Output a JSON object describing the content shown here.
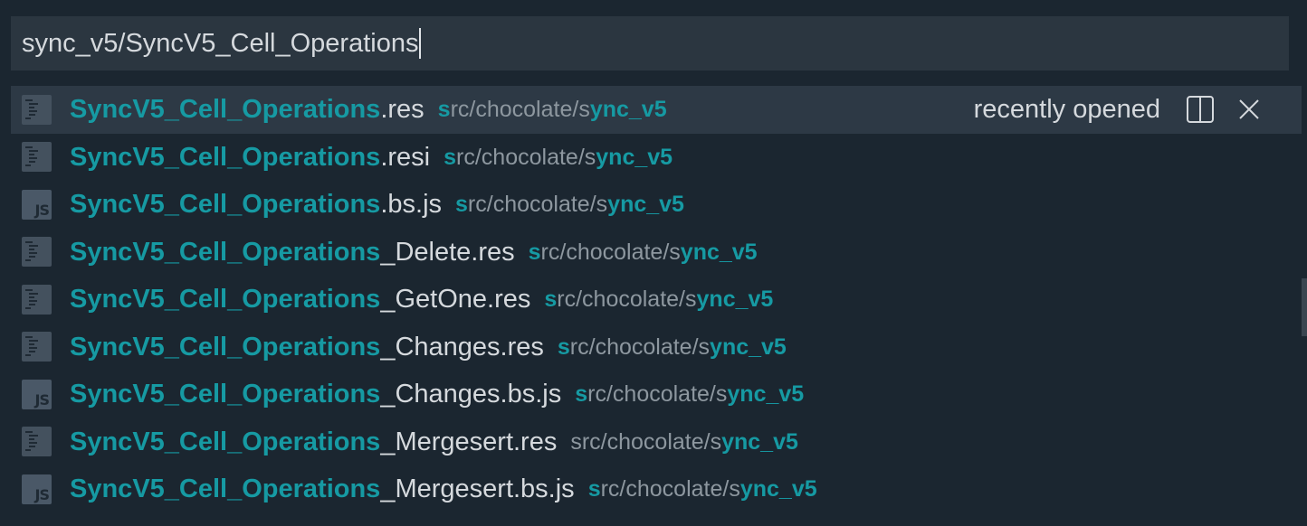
{
  "search": {
    "value": "sync_v5/SyncV5_Cell_Operations"
  },
  "results": [
    {
      "icon": "res-file-icon",
      "match": "SyncV5_Cell_Operations",
      "rest": ".res",
      "path_hl1": "s",
      "path_mid": "rc/chocolate/s",
      "path_hl2": "ync_v5",
      "selected": true
    },
    {
      "icon": "res-file-icon",
      "match": "SyncV5_Cell_Operations",
      "rest": ".resi",
      "path_hl1": "s",
      "path_mid": "rc/chocolate/s",
      "path_hl2": "ync_v5",
      "selected": false
    },
    {
      "icon": "js-file-icon",
      "match": "SyncV5_Cell_Operations",
      "rest": ".bs.js",
      "path_hl1": "s",
      "path_mid": "rc/chocolate/s",
      "path_hl2": "ync_v5",
      "selected": false
    },
    {
      "icon": "res-file-icon",
      "match": "SyncV5_Cell_Operations",
      "rest": "_Delete.res",
      "path_hl1": "s",
      "path_mid": "rc/chocolate/s",
      "path_hl2": "ync_v5",
      "selected": false
    },
    {
      "icon": "res-file-icon",
      "match": "SyncV5_Cell_Operations",
      "rest": "_GetOne.res",
      "path_hl1": "s",
      "path_mid": "rc/chocolate/s",
      "path_hl2": "ync_v5",
      "selected": false
    },
    {
      "icon": "res-file-icon",
      "match": "SyncV5_Cell_Operations",
      "rest": "_Changes.res",
      "path_hl1": "s",
      "path_mid": "rc/chocolate/s",
      "path_hl2": "ync_v5",
      "selected": false
    },
    {
      "icon": "js-file-icon",
      "match": "SyncV5_Cell_Operations",
      "rest": "_Changes.bs.js",
      "path_hl1": "s",
      "path_mid": "rc/chocolate/s",
      "path_hl2": "ync_v5",
      "selected": false
    },
    {
      "icon": "res-file-icon",
      "match": "SyncV5_Cell_Operations",
      "rest": "_Mergesert.res",
      "path_hl1": "",
      "path_mid": "src/chocolate/s",
      "path_hl2": "ync_v5",
      "selected": false
    },
    {
      "icon": "js-file-icon",
      "match": "SyncV5_Cell_Operations",
      "rest": "_Mergesert.bs.js",
      "path_hl1": "s",
      "path_mid": "rc/chocolate/s",
      "path_hl2": "ync_v5",
      "selected": false
    }
  ],
  "selected_row": {
    "badge": "recently opened",
    "split_icon": "split-editor-icon",
    "close_icon": "close-icon"
  },
  "js_icon_text": "JS",
  "colors": {
    "background": "#1b2630",
    "input_background": "#2b3640",
    "selected_background": "#2d3945",
    "highlight": "#169aa3",
    "text": "#d5d9dd",
    "path_text": "#8d979f"
  }
}
